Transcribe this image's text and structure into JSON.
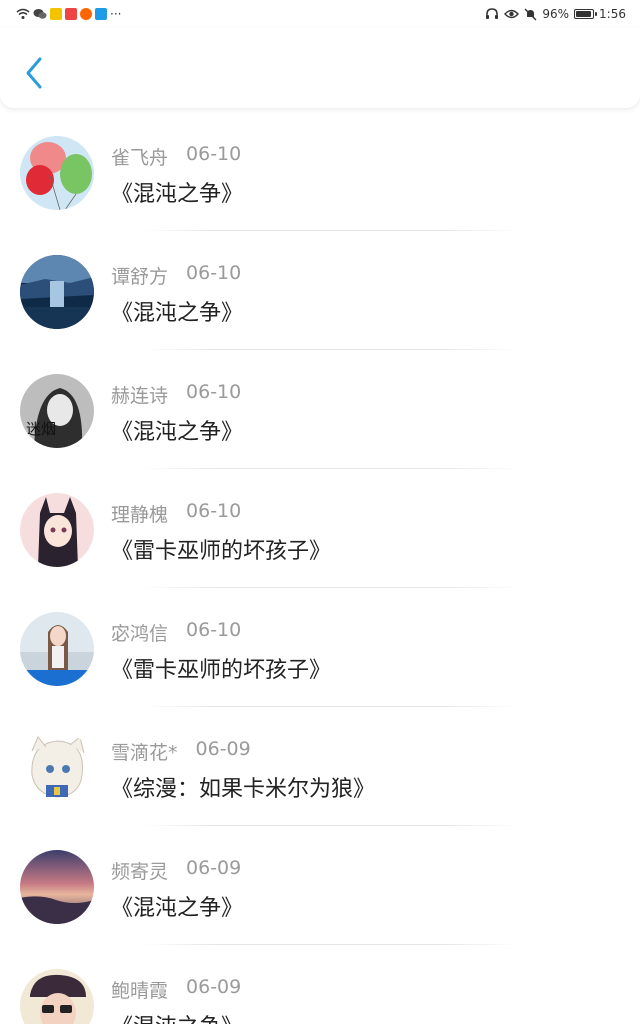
{
  "status": {
    "battery": "96%",
    "time": "1:56",
    "more": "···",
    "battery_level": 0.96
  },
  "header": {
    "back_icon": "chevron-left-icon",
    "accent": "#2b9be0"
  },
  "list": [
    {
      "name": "雀飞舟",
      "date": "06-10",
      "book": "《混沌之争》"
    },
    {
      "name": "谭舒方",
      "date": "06-10",
      "book": "《混沌之争》"
    },
    {
      "name": "赫连诗",
      "date": "06-10",
      "book": "《混沌之争》"
    },
    {
      "name": "理静槐",
      "date": "06-10",
      "book": "《雷卡巫师的坏孩子》"
    },
    {
      "name": "宓鸿信",
      "date": "06-10",
      "book": "《雷卡巫师的坏孩子》"
    },
    {
      "name": "雪滴花*",
      "date": "06-09",
      "book": "《综漫：如果卡米尔为狼》"
    },
    {
      "name": "频寄灵",
      "date": "06-09",
      "book": "《混沌之争》"
    },
    {
      "name": "鲍晴霞",
      "date": "06-09",
      "book": "《混沌之争》"
    }
  ],
  "avatar_text": {
    "a3": "迷烟"
  }
}
